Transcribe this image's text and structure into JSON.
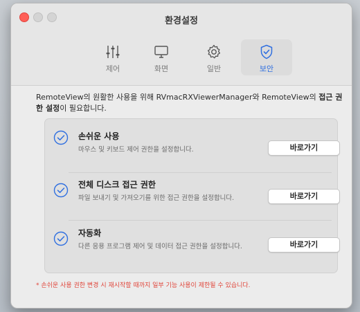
{
  "window": {
    "title": "환경설정"
  },
  "tabs": [
    {
      "label": "제어",
      "icon": "sliders-icon",
      "active": false
    },
    {
      "label": "화면",
      "icon": "display-icon",
      "active": false
    },
    {
      "label": "일반",
      "icon": "gear-icon",
      "active": false
    },
    {
      "label": "보안",
      "icon": "shield-check-icon",
      "active": true
    }
  ],
  "intro": {
    "part1": "RemoteView의 원활한 사용을 위해 RVmacRXViewerManager와 RemoteView의 ",
    "bold": "접근 권한 설정",
    "part2": "이 필요합니다."
  },
  "permissions": [
    {
      "title": "손쉬운 사용",
      "description": "마우스 및 키보드 제어 권한을 설정합니다.",
      "button": "바로가기",
      "granted": true
    },
    {
      "title": "전체 디스크 접근 권한",
      "description": "파일 보내기 및 가져오기를 위한 접근 권한을 설정합니다.",
      "button": "바로가기",
      "granted": true
    },
    {
      "title": "자동화",
      "description": "다른 응용 프로그램 제어 및 데이터 접근 권한을 설정합니다.",
      "button": "바로가기",
      "granted": true
    }
  ],
  "warning": "* 손쉬운 사용 권한 변경 시 재시작할 때까지 일부 기능 사용이 제한될 수 있습니다.",
  "colors": {
    "accent": "#2f6fe0",
    "warning": "#e0453a",
    "close": "#ff5f57"
  }
}
